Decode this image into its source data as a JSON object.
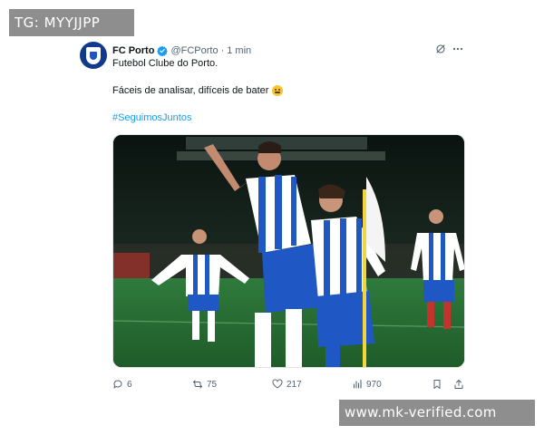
{
  "watermarks": {
    "top": "TG: MYYJJPP",
    "bottom": "www.mk-verified.com"
  },
  "tweet": {
    "author_name": "FC Porto",
    "handle": "@FCPorto",
    "separator": "·",
    "time": "1 min",
    "lines": [
      "Futebol Clube do Porto.",
      "Fáceis de analisar, difíceis de bater"
    ],
    "hashtag": "#SeguimosJuntos",
    "media_description_icon": "photo",
    "emoji": "slightly-smiling-face"
  },
  "actions": {
    "replies": "6",
    "reposts": "75",
    "likes": "217",
    "views": "970"
  },
  "icons": [
    "verified-badge-icon",
    "grok-icon",
    "more-icon",
    "reply-icon",
    "repost-icon",
    "like-icon",
    "views-icon",
    "bookmark-icon",
    "share-icon"
  ],
  "colors": {
    "accent": "#1d9bf0",
    "text": "#0f1419",
    "muted": "#536471",
    "watermark_bg": "#8e8e8e"
  }
}
